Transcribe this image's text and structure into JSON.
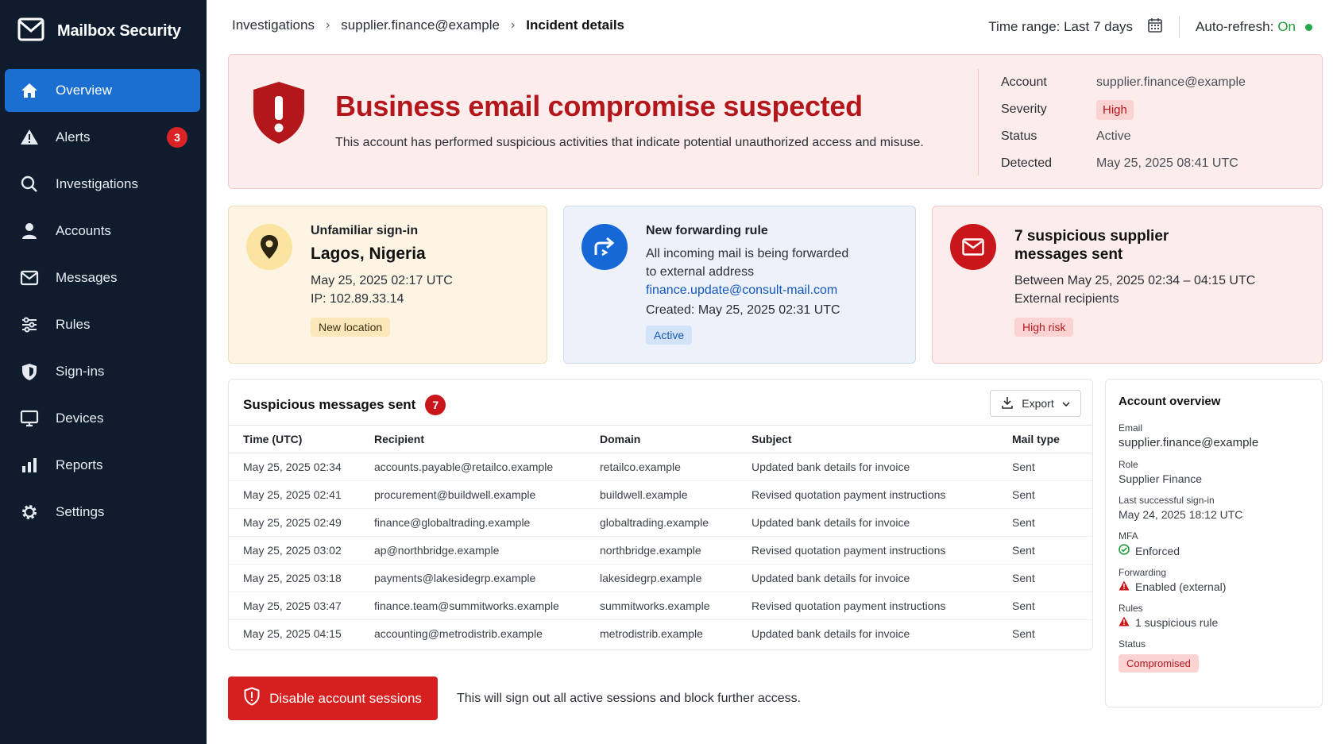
{
  "app": {
    "title": "Mailbox Security"
  },
  "sidebar": {
    "items": [
      {
        "label": "Overview",
        "icon": "home-icon",
        "active": true
      },
      {
        "label": "Alerts",
        "icon": "warning-icon",
        "badge": "3"
      },
      {
        "label": "Investigations",
        "icon": "search-icon"
      },
      {
        "label": "Accounts",
        "icon": "user-icon"
      },
      {
        "label": "Messages",
        "icon": "mail-icon"
      },
      {
        "label": "Rules",
        "icon": "sliders-icon"
      },
      {
        "label": "Sign-ins",
        "icon": "shield-icon"
      },
      {
        "label": "Devices",
        "icon": "monitor-icon"
      },
      {
        "label": "Reports",
        "icon": "bar-chart-icon"
      },
      {
        "label": "Settings",
        "icon": "gear-icon"
      }
    ]
  },
  "breadcrumb": {
    "items": [
      "Investigations",
      "supplier.finance@example"
    ],
    "current": "Incident details"
  },
  "topbar": {
    "time_range": "Time range: Last 7 days",
    "auto_refresh_label": "Auto-refresh:",
    "auto_refresh_value": "On"
  },
  "incident": {
    "title": "Business email compromise suspected",
    "description": "This account has performed suspicious activities that indicate potential unauthorized access and misuse.",
    "meta": {
      "account_label": "Account",
      "account": "supplier.finance@example",
      "severity_label": "Severity",
      "severity": "High",
      "status_label": "Status",
      "status": "Active",
      "detected_label": "Detected",
      "detected": "May 25, 2025 08:41 UTC"
    }
  },
  "cards": {
    "signin": {
      "label": "Unfamiliar sign-in",
      "location": "Lagos, Nigeria",
      "time": "May 25, 2025 02:17 UTC",
      "ip": "IP: 102.89.33.14",
      "tag": "New location"
    },
    "forwarding": {
      "label": "New forwarding rule",
      "line1": "All incoming mail is being forwarded",
      "line2": "to external address",
      "address": "finance.update@consult-mail.com",
      "created": "Created: May 25, 2025 02:31 UTC",
      "tag": "Active"
    },
    "messages": {
      "title1": "7 suspicious supplier",
      "title2": "messages sent",
      "range": "Between May 25, 2025 02:34 – 04:15 UTC",
      "recipients": "External recipients",
      "tag": "High risk"
    }
  },
  "messages_table": {
    "title": "Suspicious messages sent",
    "count": "7",
    "export_label": "Export",
    "columns": [
      "Time (UTC)",
      "Recipient",
      "Domain",
      "Subject",
      "Mail type"
    ],
    "rows": [
      [
        "May 25, 2025 02:34",
        "accounts.payable@retailco.example",
        "retailco.example",
        "Updated bank details for invoice",
        "Sent"
      ],
      [
        "May 25, 2025 02:41",
        "procurement@buildwell.example",
        "buildwell.example",
        "Revised quotation payment instructions",
        "Sent"
      ],
      [
        "May 25, 2025 02:49",
        "finance@globaltrading.example",
        "globaltrading.example",
        "Updated bank details for invoice",
        "Sent"
      ],
      [
        "May 25, 2025 03:02",
        "ap@northbridge.example",
        "northbridge.example",
        "Revised quotation payment instructions",
        "Sent"
      ],
      [
        "May 25, 2025 03:18",
        "payments@lakesidegrp.example",
        "lakesidegrp.example",
        "Updated bank details for invoice",
        "Sent"
      ],
      [
        "May 25, 2025 03:47",
        "finance.team@summitworks.example",
        "summitworks.example",
        "Revised quotation payment instructions",
        "Sent"
      ],
      [
        "May 25, 2025 04:15",
        "accounting@metrodistrib.example",
        "metrodistrib.example",
        "Updated bank details for invoice",
        "Sent"
      ]
    ]
  },
  "account_overview": {
    "title": "Account overview",
    "email_label": "Email",
    "email": "supplier.finance@example",
    "role_label": "Role",
    "role": "Supplier Finance",
    "last_signin_label": "Last successful sign-in",
    "last_signin": "May 24, 2025 18:12 UTC",
    "mfa_label": "MFA",
    "mfa": "Enforced",
    "forwarding_label": "Forwarding",
    "forwarding": "Enabled (external)",
    "rules_label": "Rules",
    "rules": "1 suspicious rule",
    "status_label": "Status",
    "status": "Compromised"
  },
  "action": {
    "button_label": "Disable account sessions",
    "note": "This will sign out all active sessions and block further access."
  },
  "colors": {
    "accent": "#1a6fd0",
    "danger": "#d62020",
    "sidebar_bg": "#0f1c2e"
  }
}
